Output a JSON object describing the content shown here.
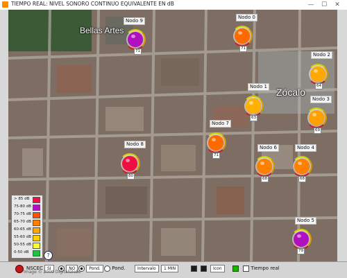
{
  "window": {
    "title": "TIEMPO REAL: NIVEL SONORO CONTINUO EQUIVALENTE EN dB",
    "minimize": "—",
    "maximize": "☐",
    "close": "✕"
  },
  "map_labels": {
    "bellas_artes": "Bellas Artes",
    "zocalo": "Zócalo"
  },
  "nodes": [
    {
      "name": "Nodo 9",
      "value": "71",
      "color": "#b010c0"
    },
    {
      "name": "Nodo 0",
      "value": "71",
      "color": "#ff6a00"
    },
    {
      "name": "Nodo 2",
      "value": "64",
      "color": "#ffa800"
    },
    {
      "name": "Nodo 1",
      "value": "63",
      "color": "#ffb000"
    },
    {
      "name": "Nodo 3",
      "value": "69",
      "color": "#ffa000"
    },
    {
      "name": "Nodo 7",
      "value": "71",
      "color": "#ff6a00"
    },
    {
      "name": "Nodo 8",
      "value": "80",
      "color": "#ee1040"
    },
    {
      "name": "Nodo 6",
      "value": "68",
      "color": "#ff8000"
    },
    {
      "name": "Nodo 4",
      "value": "68",
      "color": "#ff8000"
    },
    {
      "name": "Nodo 5",
      "value": "79",
      "color": "#b010c0"
    }
  ],
  "legend": [
    {
      "label": "> 85 dB",
      "color": "#ee1040"
    },
    {
      "label": "75-80 dB",
      "color": "#b010c0"
    },
    {
      "label": "70-75 dB",
      "color": "#ff5000"
    },
    {
      "label": "65-70 dB",
      "color": "#ff8000"
    },
    {
      "label": "60-65 dB",
      "color": "#ffa800"
    },
    {
      "label": "55-60 dB",
      "color": "#ffd000"
    },
    {
      "label": "50-55 dB",
      "color": "#ffff30"
    },
    {
      "label": "0-50 dB",
      "color": "#20c040"
    }
  ],
  "help": "?",
  "bottom": {
    "nsec": "NSCEC",
    "si": "SI",
    "no": "NO",
    "pond1": "Pond.",
    "pond2": "Pond.",
    "intervalo": "Intervalo",
    "interval_value": "1 MIN",
    "icon": "Icon",
    "tiempo_real": "Tiempo real",
    "watermark": "Image © 2009 DigitalGlobe"
  }
}
